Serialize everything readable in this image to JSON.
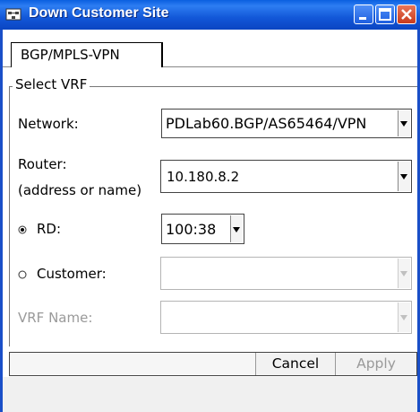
{
  "window": {
    "title": "Down Customer Site",
    "app_icon": "network-site-icon",
    "controls": [
      "minimize-icon",
      "maximize-icon",
      "close-icon"
    ]
  },
  "tabs": [
    {
      "label": "BGP/MPLS-VPN",
      "selected": true
    }
  ],
  "group": {
    "title": "Select VRF"
  },
  "form": {
    "network": {
      "label": "Network:",
      "value": "PDLab60.BGP/AS65464/VPN"
    },
    "router": {
      "label_line1": "Router:",
      "label_line2": "(address or name)",
      "value": "10.180.8.2"
    },
    "rd": {
      "label": "RD:",
      "value": "100:38",
      "selected": true
    },
    "customer": {
      "label": "Customer:",
      "value": "",
      "selected": false,
      "enabled": false
    },
    "vrf_name": {
      "label": "VRF Name:",
      "value": "",
      "enabled": false
    }
  },
  "buttons": {
    "cancel": "Cancel",
    "apply": "Apply"
  },
  "colors": {
    "titlebar": "#0b4fd6",
    "disabled_text": "#9a9a9a"
  }
}
